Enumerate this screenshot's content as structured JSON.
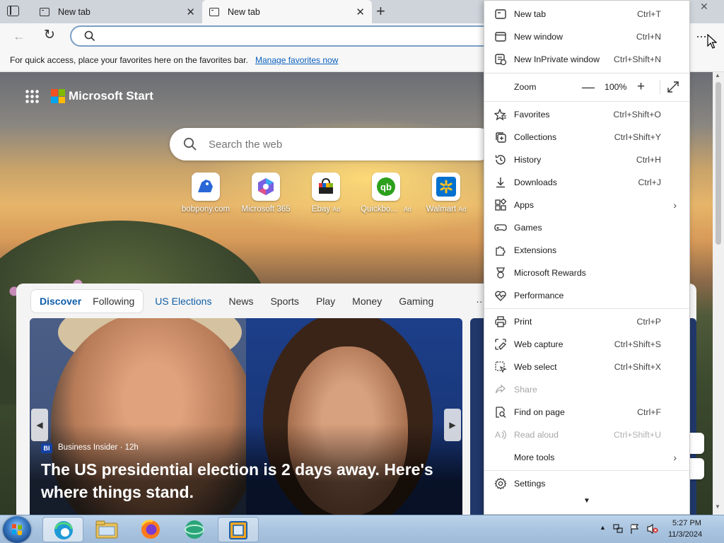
{
  "browser": {
    "tabs": [
      {
        "label": "New tab",
        "active": false
      },
      {
        "label": "New tab",
        "active": true
      }
    ],
    "new_tab_symbol": "+",
    "window_close_symbol": "✕",
    "address_value": "",
    "more_symbol": "···"
  },
  "favorites_bar": {
    "text": "For quick access, place your favorites here on the favorites bar.",
    "link": "Manage favorites now"
  },
  "start_page": {
    "brand": "Microsoft Start",
    "search_placeholder": "Search the web",
    "quick_links": [
      {
        "label": "bobpony.com",
        "ad": "",
        "icon": "bobpony-icon"
      },
      {
        "label": "Microsoft 365",
        "ad": "",
        "icon": "microsoft-365-icon"
      },
      {
        "label": "Ebay",
        "ad": "Ad",
        "icon": "ebay-icon"
      },
      {
        "label": "Quickbo...",
        "ad": "Ad",
        "icon": "quickbooks-icon"
      },
      {
        "label": "Walmart",
        "ad": "Ad",
        "icon": "walmart-icon"
      }
    ],
    "news_tabs": {
      "pill": [
        "Discover",
        "Following"
      ],
      "others": [
        "US Elections",
        "News",
        "Sports",
        "Play",
        "Money",
        "Gaming"
      ],
      "more": "···"
    },
    "hero": {
      "source_badge": "BI",
      "source": "Business Insider · 12h",
      "headline": "The US presidential election is 2 days away. Here's where things stand."
    }
  },
  "menu": {
    "items": [
      {
        "label": "New tab",
        "shortcut": "Ctrl+T",
        "icon": "new-tab-icon"
      },
      {
        "label": "New window",
        "shortcut": "Ctrl+N",
        "icon": "new-window-icon"
      },
      {
        "label": "New InPrivate window",
        "shortcut": "Ctrl+Shift+N",
        "icon": "inprivate-icon"
      }
    ],
    "zoom": {
      "label": "Zoom",
      "minus": "—",
      "value": "100%",
      "plus": "+"
    },
    "items2": [
      {
        "label": "Favorites",
        "shortcut": "Ctrl+Shift+O",
        "icon": "favorites-icon"
      },
      {
        "label": "Collections",
        "shortcut": "Ctrl+Shift+Y",
        "icon": "collections-icon"
      },
      {
        "label": "History",
        "shortcut": "Ctrl+H",
        "icon": "history-icon"
      },
      {
        "label": "Downloads",
        "shortcut": "Ctrl+J",
        "icon": "downloads-icon"
      },
      {
        "label": "Apps",
        "shortcut": "",
        "icon": "apps-icon",
        "submenu": true
      },
      {
        "label": "Games",
        "shortcut": "",
        "icon": "games-icon"
      },
      {
        "label": "Extensions",
        "shortcut": "",
        "icon": "extensions-icon"
      },
      {
        "label": "Microsoft Rewards",
        "shortcut": "",
        "icon": "rewards-icon"
      },
      {
        "label": "Performance",
        "shortcut": "",
        "icon": "performance-icon"
      }
    ],
    "items3": [
      {
        "label": "Print",
        "shortcut": "Ctrl+P",
        "icon": "print-icon"
      },
      {
        "label": "Web capture",
        "shortcut": "Ctrl+Shift+S",
        "icon": "web-capture-icon"
      },
      {
        "label": "Web select",
        "shortcut": "Ctrl+Shift+X",
        "icon": "web-select-icon"
      },
      {
        "label": "Share",
        "shortcut": "",
        "icon": "share-icon",
        "disabled": true
      },
      {
        "label": "Find on page",
        "shortcut": "Ctrl+F",
        "icon": "find-icon"
      },
      {
        "label": "Read aloud",
        "shortcut": "Ctrl+Shift+U",
        "icon": "read-aloud-icon",
        "disabled": true
      },
      {
        "label": "More tools",
        "shortcut": "",
        "icon": "",
        "submenu": true
      }
    ],
    "items4": [
      {
        "label": "Settings",
        "shortcut": "",
        "icon": "settings-icon"
      }
    ],
    "submenu_arrow": "›",
    "scroll_down_symbol": "▼"
  },
  "taskbar": {
    "time": "5:27 PM",
    "date": "11/3/2024"
  },
  "colors": {
    "accent": "#0f5ea8",
    "link": "#0a5fbd",
    "ms_red": "#f25022",
    "ms_green": "#7fba00",
    "ms_blue": "#00a4ef",
    "ms_yellow": "#ffb900"
  }
}
